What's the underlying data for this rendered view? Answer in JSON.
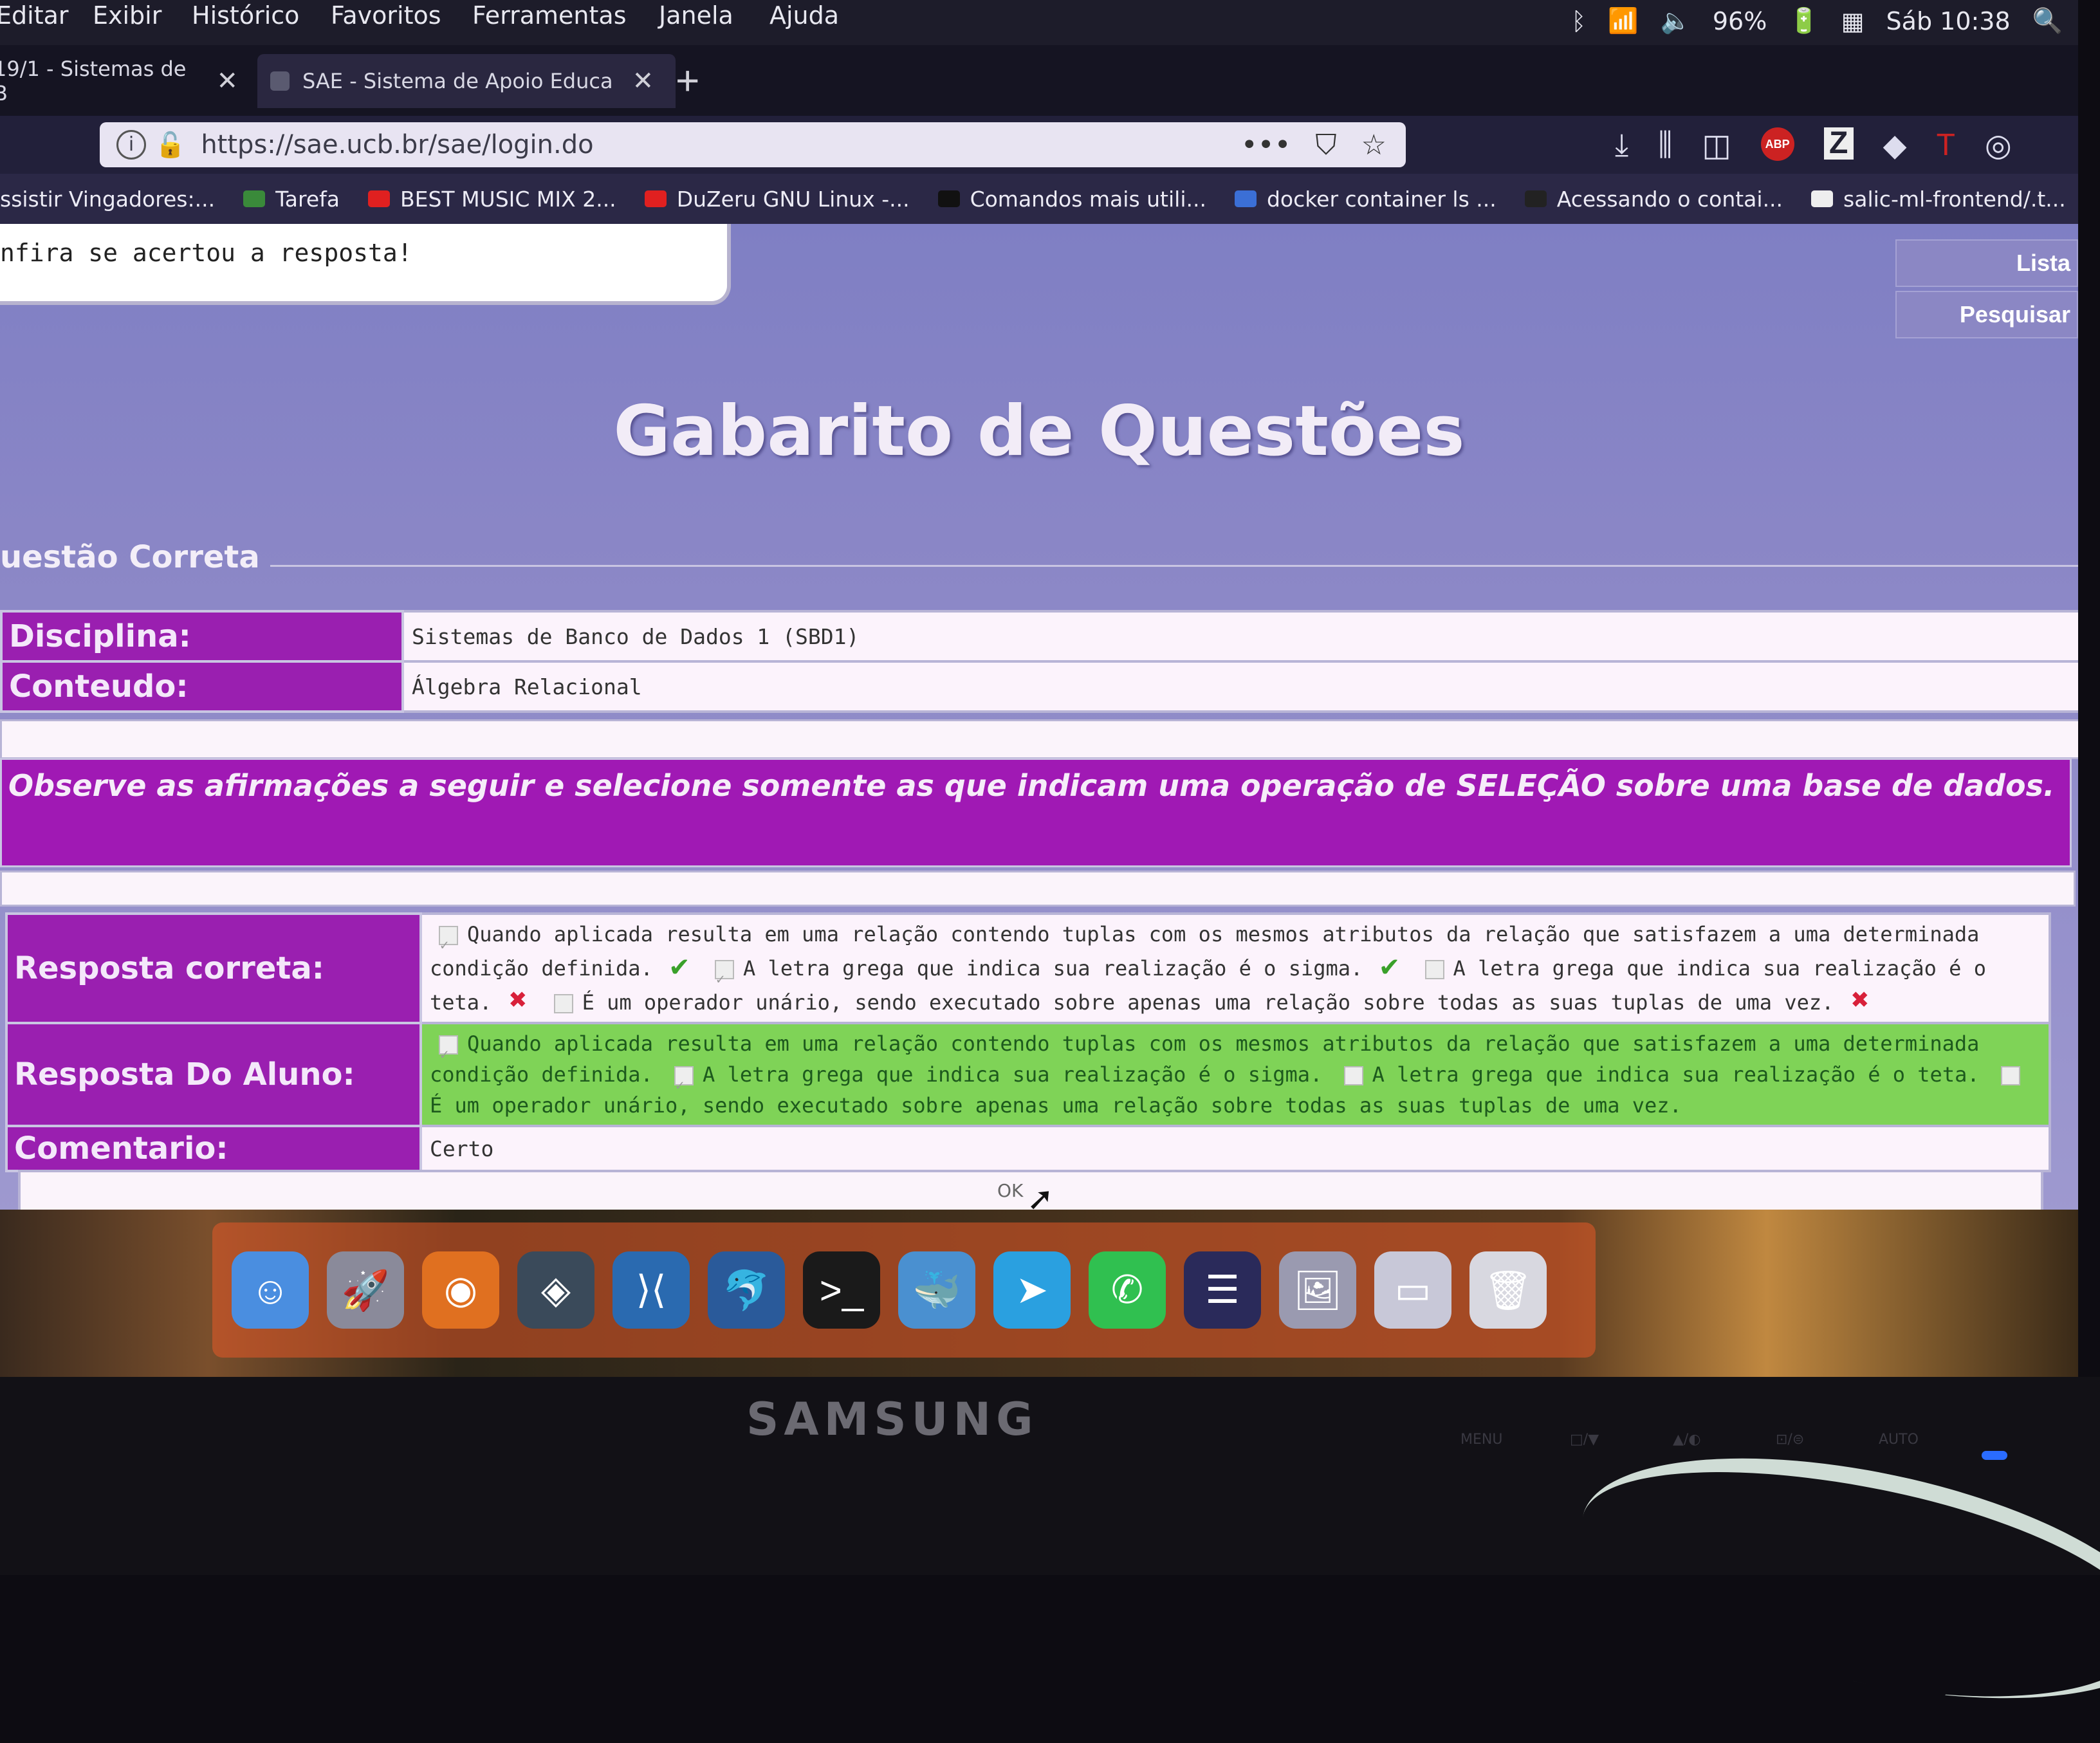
{
  "menubar": {
    "items": [
      "Editar",
      "Exibir",
      "Histórico",
      "Favoritos",
      "Ferramentas",
      "Janela",
      "Ajuda"
    ],
    "battery": "96%",
    "clock": "Sáb 10:38"
  },
  "tabs": [
    {
      "label": "19/1 - Sistemas de B"
    },
    {
      "label": "SAE - Sistema de Apoio Educa"
    }
  ],
  "url": "https://sae.ucb.br/sae/login.do",
  "bookmarks": [
    {
      "label": "ssistir Vingadores:...",
      "icon": "",
      "color": ""
    },
    {
      "label": "Tarefa",
      "icon": "tarefa-icon",
      "color": "#3a8a3a"
    },
    {
      "label": "BEST MUSIC MIX 2...",
      "icon": "youtube-icon",
      "color": "#e02020"
    },
    {
      "label": "DuZeru GNU Linux -...",
      "icon": "youtube-icon",
      "color": "#e02020"
    },
    {
      "label": "Comandos mais utili...",
      "icon": "circle-icon",
      "color": "#111111"
    },
    {
      "label": "docker container ls ...",
      "icon": "globe-icon",
      "color": "#3b6fd6"
    },
    {
      "label": "Acessando o contai...",
      "icon": "a-icon",
      "color": "#222222"
    },
    {
      "label": "salic-ml-frontend/.t...",
      "icon": "github-icon",
      "color": "#eeeeee"
    }
  ],
  "page": {
    "message": "nfira se acertou a resposta!",
    "side_links": [
      "Lista",
      "Pesquisar"
    ],
    "title": "Gabarito de Questões",
    "section": "uestão Correta",
    "disciplina_label": "Disciplina:",
    "disciplina": "Sistemas de Banco de Dados 1 (SBD1)",
    "conteudo_label": "Conteudo:",
    "conteudo": "Álgebra Relacional",
    "question": "Observe as afirmações a seguir e selecione somente as que indicam uma operação de SELEÇÃO sobre uma base de dados.",
    "correct_label": "Resposta correta:",
    "student_label": "Resposta Do Aluno:",
    "comment_label": "Comentario:",
    "comment": "Certo",
    "options": [
      "Quando aplicada resulta em uma relação contendo tuplas com os mesmos atributos da relação que satisfazem a uma determinada condição definida.",
      "A letra grega que indica sua realização é o sigma.",
      "A letra grega que indica sua realização é o teta.",
      "É um operador unário, sendo executado sobre apenas uma relação sobre todas as suas tuplas de uma vez."
    ],
    "ok": "OK"
  },
  "dock": [
    {
      "icon": "finder-icon",
      "color": "#4a8ee0"
    },
    {
      "icon": "launchpad-icon",
      "color": "#8a8a9a"
    },
    {
      "icon": "firefox-icon",
      "color": "#e07020"
    },
    {
      "icon": "sublime-icon",
      "color": "#3a4a5a"
    },
    {
      "icon": "vscode-icon",
      "color": "#2a6ab0"
    },
    {
      "icon": "mysql-workbench-icon",
      "color": "#2a5a9a"
    },
    {
      "icon": "terminal-icon",
      "color": "#1a1a1a"
    },
    {
      "icon": "docker-icon",
      "color": "#4a90d0"
    },
    {
      "icon": "telegram-icon",
      "color": "#2aa0e0"
    },
    {
      "icon": "whatsapp-icon",
      "color": "#30c050"
    },
    {
      "icon": "eclipse-icon",
      "color": "#2a2a5a"
    },
    {
      "icon": "preview-icon",
      "color": "#9a9ab0"
    },
    {
      "icon": "screen-share-icon",
      "color": "#c8c8d8"
    },
    {
      "icon": "trash-icon",
      "color": "#d8d8e0"
    }
  ],
  "monitor": {
    "brand": "SAMSUNG",
    "buttons": [
      "MENU",
      "□/▼",
      "▲/◐",
      "⊡/⊜",
      "AUTO"
    ]
  }
}
